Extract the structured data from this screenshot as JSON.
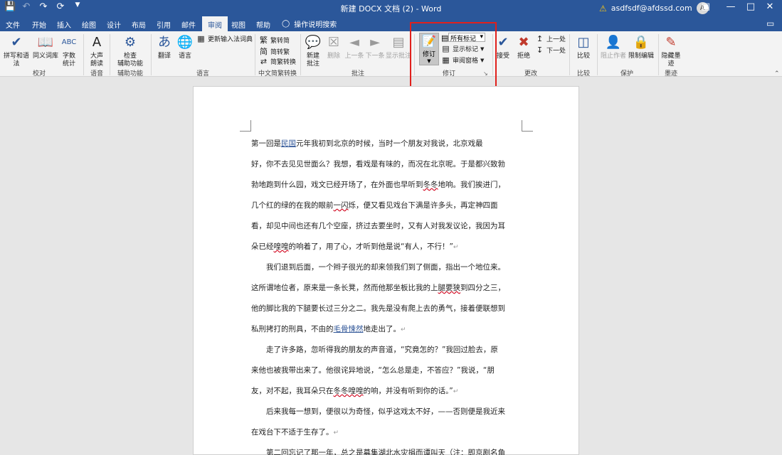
{
  "titlebar": {
    "title": "新建 DOCX 文档 (2) - Word",
    "user": "asdfsdf@afdssd.com",
    "avatar_initial": "A",
    "icons": [
      "save-icon",
      "undo-icon",
      "redo-icon",
      "repeat-icon",
      "customize-qat-icon"
    ]
  },
  "tabs": [
    "文件",
    "开始",
    "插入",
    "绘图",
    "设计",
    "布局",
    "引用",
    "邮件",
    "审阅",
    "视图",
    "帮助"
  ],
  "active_tab": "审阅",
  "tellme": "操作说明搜索",
  "ribbon": {
    "proofing": {
      "spelling": "拼写和语法",
      "thesaurus": "同义词库",
      "wordcount": "字数\n统计",
      "group": "校对"
    },
    "speech": {
      "readaloud": "大声\n朗读",
      "group": "语音"
    },
    "accessibility": {
      "check": "检查\n辅助功能",
      "group": "辅助功能"
    },
    "language": {
      "translate": "翻译",
      "language": "语言",
      "ime": "更新输入法词典",
      "group": "语言"
    },
    "chinese": {
      "to_trad": "繁转简",
      "to_simp": "简转繁",
      "convert": "简繁转换",
      "group": "中文简繁转换"
    },
    "comments": {
      "new": "新建\n批注",
      "delete": "删除",
      "prev": "上一条",
      "next": "下一条",
      "show": "显示批注",
      "group": "批注"
    },
    "tracking": {
      "track": "修订",
      "markup_select": "所有标记",
      "show_markup": "显示标记",
      "pane": "审阅窗格",
      "group": "修订"
    },
    "changes": {
      "accept": "接受",
      "reject": "拒绝",
      "prev": "上一处",
      "next": "下一处",
      "group": "更改"
    },
    "compare": {
      "compare": "比较",
      "group": "比较"
    },
    "protect": {
      "block": "阻止作者",
      "restrict": "限制编辑",
      "group": "保护"
    },
    "ink": {
      "hide": "隐藏墨\n迹",
      "group": "墨迹"
    }
  },
  "document": {
    "paragraphs": [
      {
        "lines": [
          [
            {
              "t": "第一回是"
            },
            {
              "t": "民国",
              "s": "link"
            },
            {
              "t": "元年我初到北京的时候，当时一个朋友对我说，北京戏最"
            }
          ],
          [
            {
              "t": "好，你不去见见世面么？我想，看戏是有味的，而况在北京呢。于是都兴致勃"
            }
          ],
          [
            {
              "t": "勃地跑到什么园，戏文已经开场了，在外面也早听到"
            },
            {
              "t": "冬冬",
              "s": "wavy"
            },
            {
              "t": "地响。我们挨进门，"
            }
          ],
          [
            {
              "t": "几个红的绿的在我的眼前"
            },
            {
              "t": "一闪",
              "s": "wavy"
            },
            {
              "t": "烁，便又看见戏台下满是许多头，再定神四面"
            }
          ],
          [
            {
              "t": "看，却见中间也还有几个空座，挤过去要坐时，又有人对我发议论，我因为耳"
            }
          ],
          [
            {
              "t": "朵已经"
            },
            {
              "t": "喤喤",
              "s": "wavy"
            },
            {
              "t": "的响着了，用了心，才听到他是说“有人，不行！”"
            },
            {
              "t": "↵",
              "s": "pm"
            }
          ]
        ]
      },
      {
        "lines": [
          [
            {
              "t": "　　我们退到后面，一个辫子很光的却来领我们到了侧面，指出一个地位来。"
            }
          ],
          [
            {
              "t": "这所谓地位者，原来是一条长凳，然而他那坐板比我的上"
            },
            {
              "t": "腿要狭",
              "s": "wavy"
            },
            {
              "t": "到四分之三，"
            }
          ],
          [
            {
              "t": "他的脚比我的下腿要长过三分之二。我先是没有爬上去的勇气，接着便联想到"
            }
          ],
          [
            {
              "t": "私刑拷打的刑具，不由的"
            },
            {
              "t": "毛骨悚然",
              "s": "link"
            },
            {
              "t": "地走出了。"
            },
            {
              "t": "↵",
              "s": "pm"
            }
          ]
        ]
      },
      {
        "lines": [
          [
            {
              "t": "　　走了许多路，忽听得我的朋友的声音道，“究竟怎的？”我回过脸去，原"
            }
          ],
          [
            {
              "t": "来他也被我带出来了。他很诧异地说，“怎么总是走，不答应？”我说，“朋"
            }
          ],
          [
            {
              "t": "友，对不起，我耳朵只在"
            },
            {
              "t": "冬冬喤喤",
              "s": "wavy"
            },
            {
              "t": "的响，并没有听到你的话。”"
            },
            {
              "t": "↵",
              "s": "pm"
            }
          ]
        ]
      },
      {
        "lines": [
          [
            {
              "t": "　　后来我每一想到，便很以为奇怪，似乎这戏太不好，——否则便是我近来"
            }
          ],
          [
            {
              "t": "在戏台下不适于生存了。"
            },
            {
              "t": "↵",
              "s": "pm"
            }
          ]
        ]
      },
      {
        "lines": [
          [
            {
              "t": "　　第二回忘记了那一年，总之是募集湖北水灾捐而谭叫天（注：即京剧名角"
            }
          ]
        ]
      }
    ]
  }
}
